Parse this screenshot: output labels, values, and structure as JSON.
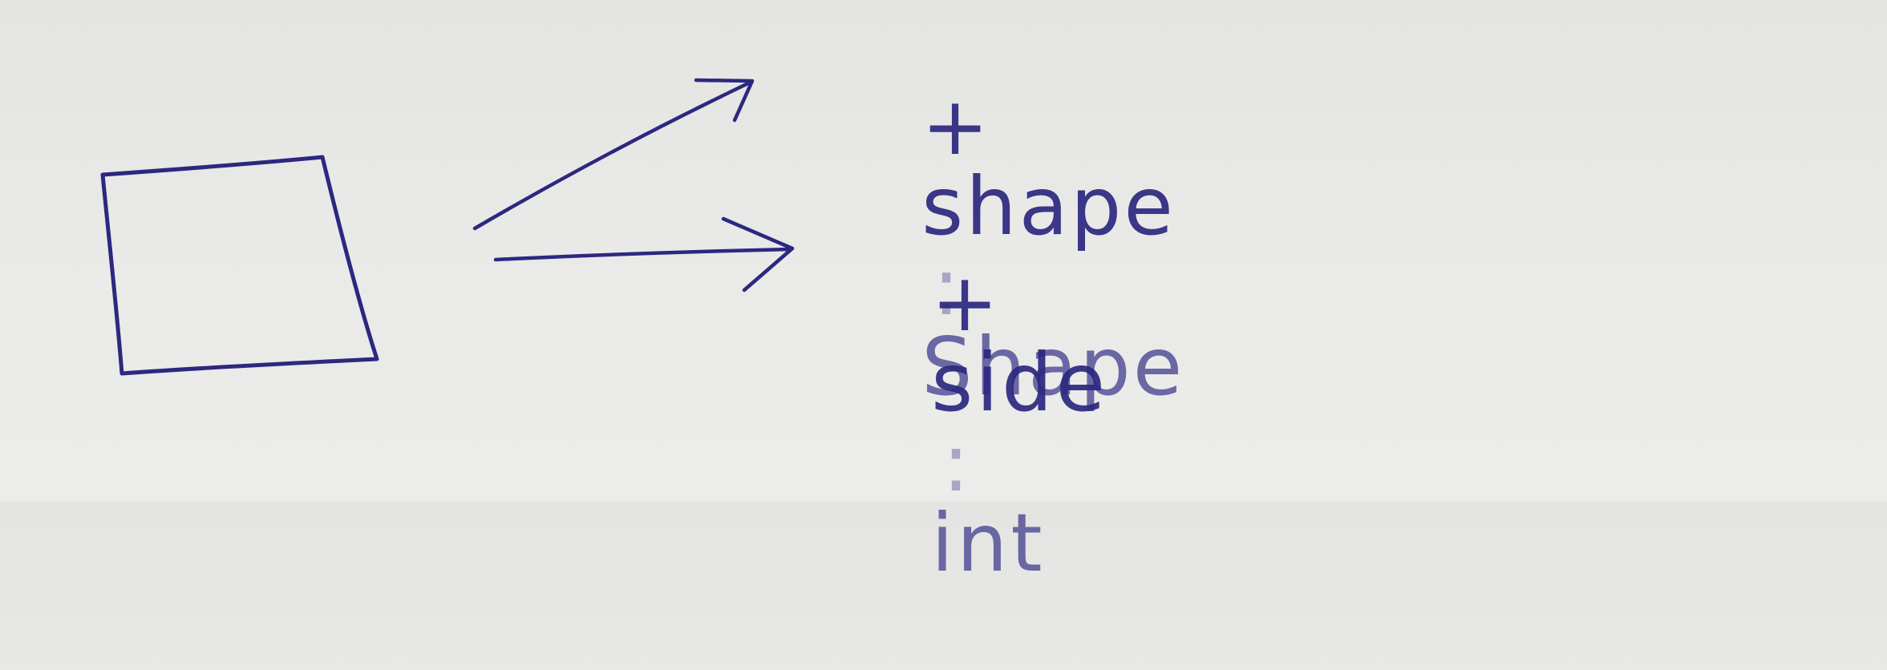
{
  "ink_color": "#2c2880",
  "paper_color": "#e8e8e6",
  "attributes": [
    {
      "visibility": "+",
      "name": "shape",
      "separator": ":",
      "type": "Shape"
    },
    {
      "visibility": "+",
      "name": "side",
      "separator": ":",
      "type": "int"
    }
  ]
}
